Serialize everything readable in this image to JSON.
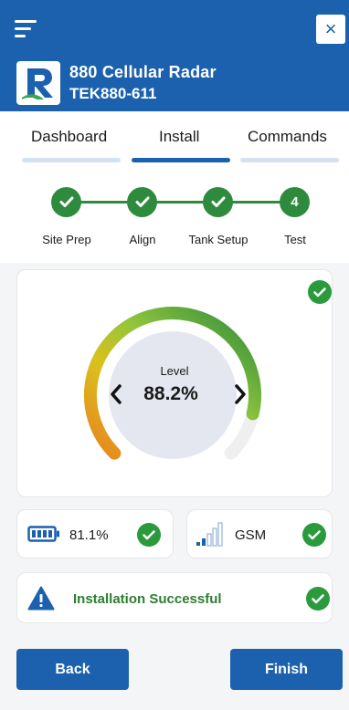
{
  "header": {
    "device_name": "880 Cellular Radar",
    "device_id": "TEK880-611",
    "close_label": "×"
  },
  "tabs": [
    {
      "label": "Dashboard",
      "active": false
    },
    {
      "label": "Install",
      "active": true
    },
    {
      "label": "Commands",
      "active": false
    }
  ],
  "steps": [
    {
      "label": "Site Prep",
      "status": "complete"
    },
    {
      "label": "Align",
      "status": "complete"
    },
    {
      "label": "Tank Setup",
      "status": "complete"
    },
    {
      "label": "Test",
      "status": "current",
      "number": "4"
    }
  ],
  "gauge": {
    "label": "Level",
    "value": "88.2%",
    "level_fraction": 0.882
  },
  "battery": {
    "value": "81.1%"
  },
  "signal": {
    "label": "GSM"
  },
  "status": {
    "message": "Installation Successful"
  },
  "footer": {
    "back_label": "Back",
    "finish_label": "Finish"
  },
  "colors": {
    "brand": "#1b61ae",
    "success": "#2a9a3c",
    "accent_text": "#2e7d32"
  }
}
